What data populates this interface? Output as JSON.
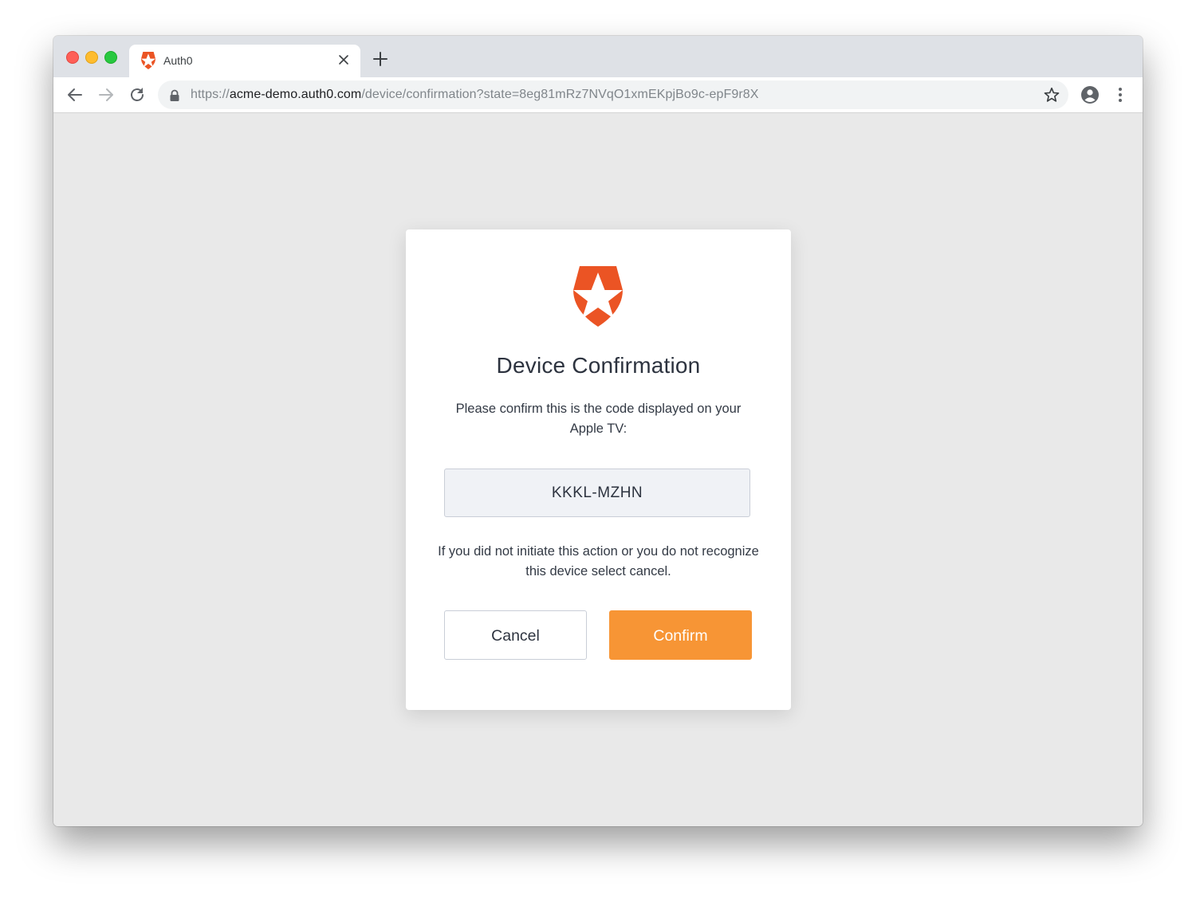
{
  "browser": {
    "tab": {
      "title": "Auth0",
      "favicon": "auth0-shield-icon",
      "close_icon": "close-icon"
    },
    "new_tab_icon": "plus-icon",
    "nav": {
      "back_icon": "arrow-left-icon",
      "forward_icon": "arrow-right-icon",
      "reload_icon": "reload-icon"
    },
    "address_bar": {
      "lock_icon": "lock-icon",
      "url_scheme": "https://",
      "url_host": "acme-demo.auth0.com",
      "url_path": "/device/confirmation?state=8eg81mRz7NVqO1xmEKpjBo9c-epF9r8X",
      "bookmark_icon": "star-icon"
    },
    "profile_icon": "account-circle-icon",
    "menu_icon": "more-vertical-icon"
  },
  "colors": {
    "brand": "#eb5424",
    "confirm_button": "#f79535",
    "page_background": "#e9e9e9",
    "code_background": "#f0f2f6"
  },
  "card": {
    "logo": "auth0-shield-icon",
    "title": "Device Confirmation",
    "description": "Please confirm this is the code displayed on your Apple TV:",
    "code": "KKKL-MZHN",
    "warning": "If you did not initiate this action or you do not recognize this device select cancel.",
    "cancel_label": "Cancel",
    "confirm_label": "Confirm"
  }
}
